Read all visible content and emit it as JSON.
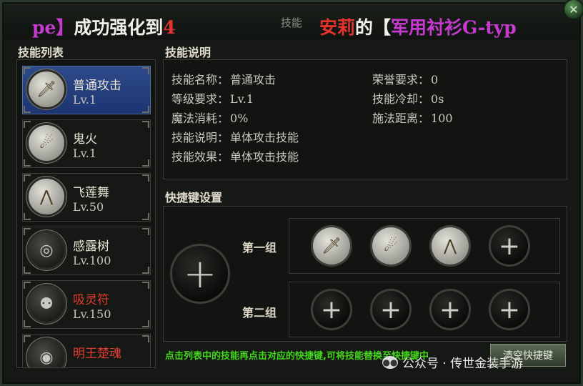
{
  "window": {
    "title_tab": "技能",
    "ticker": {
      "part1": "pe】",
      "part2": "成功强化到",
      "part3": "4",
      "part4": "安莉",
      "part5": "的【",
      "part6": "军用衬衫G-typ"
    }
  },
  "skill_list": {
    "title": "技能列表",
    "items": [
      {
        "name": "普通攻击",
        "level": "Lv.1",
        "icon": "sword-icon",
        "glyph": "🗡"
      },
      {
        "name": "鬼火",
        "level": "Lv.1",
        "icon": "flame-icon",
        "glyph": "☄"
      },
      {
        "name": "飞莲舞",
        "level": "Lv.50",
        "icon": "lotus-icon",
        "glyph": "⋀"
      },
      {
        "name": "感露树",
        "level": "Lv.100",
        "icon": "ripple-icon",
        "glyph": "◎"
      },
      {
        "name": "吸灵符",
        "level": "Lv.150",
        "icon": "talisman-icon",
        "glyph": "⚉"
      },
      {
        "name": "明王楚魂",
        "level": "",
        "icon": "eye-icon",
        "glyph": "◉"
      }
    ]
  },
  "description": {
    "title": "技能说明",
    "left": [
      {
        "label": "技能名称：",
        "value": "普通攻击"
      },
      {
        "label": "等级要求：",
        "value": "Lv.1"
      },
      {
        "label": "魔法消耗：",
        "value": "0%"
      },
      {
        "label": "技能说明：",
        "value": "单体攻击技能"
      },
      {
        "label": "技能效果：",
        "value": "单体攻击技能"
      }
    ],
    "right": [
      {
        "label": "荣誉要求：",
        "value": "0"
      },
      {
        "label": "技能冷却：",
        "value": "0s"
      },
      {
        "label": "施法距离：",
        "value": "100"
      }
    ]
  },
  "hotkeys": {
    "title": "快捷键设置",
    "plus": "+",
    "group1_label": "第一组",
    "group2_label": "第二组",
    "group1": [
      "sword-icon",
      "flame-icon",
      "lotus-icon",
      "empty"
    ],
    "group2": [
      "empty",
      "empty",
      "empty",
      "empty"
    ],
    "hint": "点击列表中的技能再点击对应的快捷键,可将技能替换至快捷键中",
    "clear_button": "清空快捷键"
  },
  "watermark": {
    "text": "公众号 · 传世金装手游"
  },
  "colors": {
    "hint_green": "#43d81c",
    "selected_blue": "#2d4a8a",
    "red_name": "#e23b30",
    "ticker_purple": "#c63ad0",
    "ticker_red": "#e5322c"
  }
}
